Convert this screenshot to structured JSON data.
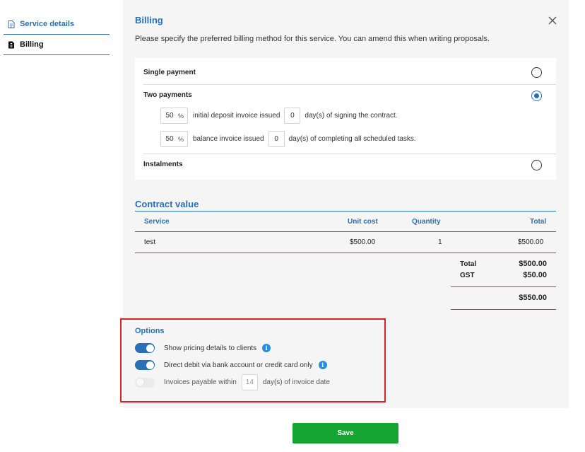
{
  "sidebar": {
    "items": [
      {
        "label": "Service details",
        "icon": "document-icon"
      },
      {
        "label": "Billing",
        "icon": "invoice-icon"
      }
    ]
  },
  "billing": {
    "title": "Billing",
    "description": "Please specify the preferred billing method for this service. You can amend this when writing proposals.",
    "methods": [
      {
        "label": "Single payment",
        "selected": false
      },
      {
        "label": "Two payments",
        "selected": true
      },
      {
        "label": "Instalments",
        "selected": false
      }
    ],
    "two_payments": {
      "deposit": {
        "percent": "50",
        "percent_symbol": "%",
        "text_before": "initial deposit invoice issued",
        "days": "0",
        "text_after": "day(s) of signing the contract."
      },
      "balance": {
        "percent": "50",
        "percent_symbol": "%",
        "text_before": "balance invoice issued",
        "days": "0",
        "text_after": "day(s) of completing all scheduled tasks."
      }
    }
  },
  "contract": {
    "title": "Contract value",
    "columns": {
      "service": "Service",
      "unit_cost": "Unit cost",
      "quantity": "Quantity",
      "total": "Total"
    },
    "rows": [
      {
        "service": "test",
        "unit_cost": "$500.00",
        "quantity": "1",
        "total": "$500.00"
      }
    ],
    "summary": {
      "total_label": "Total",
      "total_value": "$500.00",
      "gst_label": "GST",
      "gst_value": "$50.00",
      "grand_total": "$550.00"
    }
  },
  "options": {
    "title": "Options",
    "show_pricing": {
      "label": "Show pricing details to clients",
      "on": true
    },
    "direct_debit": {
      "label": "Direct debit via bank account or credit card only",
      "on": true
    },
    "invoices_payable": {
      "label_before": "Invoices payable within",
      "days": "14",
      "label_after": "day(s) of invoice date",
      "on": false
    }
  },
  "save_label": "Save",
  "colors": {
    "accent": "#2a6fb3",
    "save": "#15a532",
    "highlight": "#e02020"
  }
}
